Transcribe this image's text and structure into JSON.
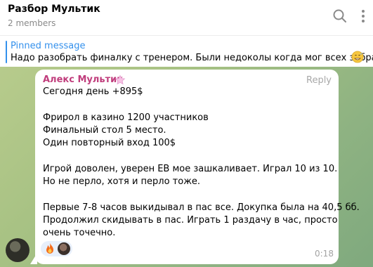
{
  "header": {
    "title": "Разбор Мультик",
    "members": "2 members"
  },
  "pinned": {
    "label": "Pinned message",
    "text": "Надо разобрать финалку с тренером. Были недоколы когда мог всех забрать"
  },
  "message": {
    "sender": "Алекс Мультик",
    "reply_label": "Reply",
    "lines": [
      "Сегодня день +895$",
      "Фрирол в казино 1200 участников",
      "Финальный стол 5 место.",
      "Один повторный вход 100$",
      "Игрой доволен, уверен EB мое зашкаливает. Играл 10 из 10.",
      "Но не перло, хотя и перло тоже.",
      "Первые 7-8 часов выкидывал в пас все. Докупка была на 40,5 бб.",
      "Продолжил скидывать в пас. Играть 1 раздачу в час, просто",
      "очень точечно."
    ],
    "time": "0:18",
    "reactions": [
      "fire",
      "user-avatar"
    ]
  },
  "colors": {
    "accent": "#3390ec",
    "sender": "#c03d7c",
    "wallpaper": "#a6c183"
  },
  "icons": [
    "search-icon",
    "more-vertical-icon",
    "star-icon",
    "fire-icon",
    "grinning-sweat-emoji"
  ]
}
